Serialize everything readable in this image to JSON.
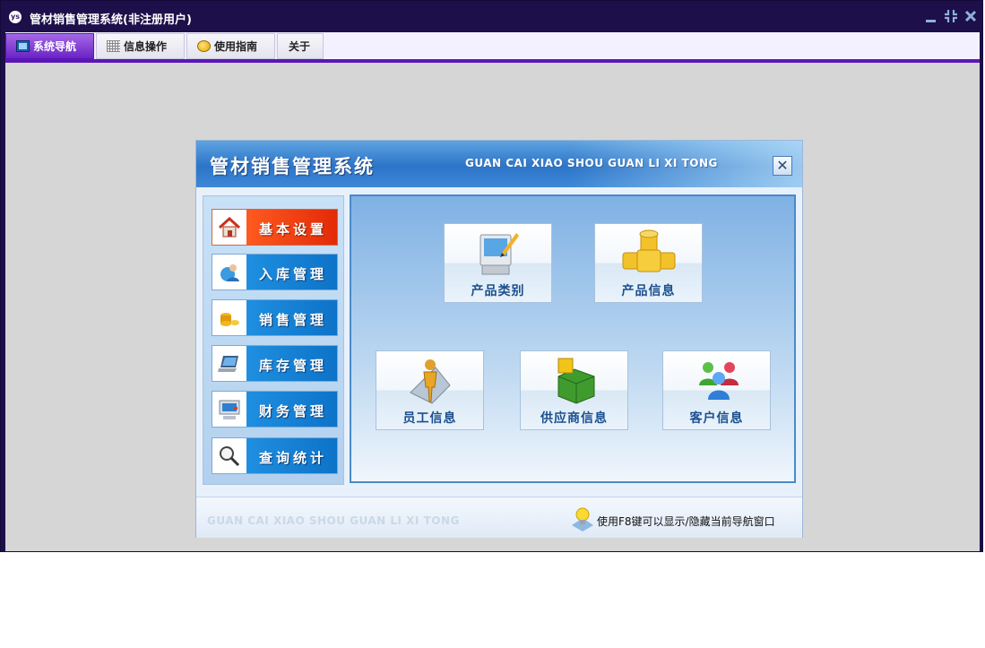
{
  "window": {
    "title": "管材销售管理系统(非注册用户)",
    "app_icon_text": "ys"
  },
  "menubar": {
    "tabs": [
      {
        "label": "系统导航",
        "icon": "monitor-icon",
        "active": true
      },
      {
        "label": "信息操作",
        "icon": "grid-icon",
        "active": false
      },
      {
        "label": "使用指南",
        "icon": "info-dot-icon",
        "active": false
      },
      {
        "label": "关于",
        "icon": "",
        "active": false
      }
    ]
  },
  "colors": {
    "accent": "#5b16b8",
    "title_bg": "#1d0f4a",
    "workspace": "#d6d6d6",
    "active_menu": "#e22a08",
    "menu_blue": "#0d73c8"
  },
  "nav": {
    "title": "管材销售管理系统",
    "subtitle": "GUAN CAI XIAO SHOU GUAN LI XI TONG",
    "close": "✕",
    "menu": [
      {
        "label": "基本设置",
        "icon": "home-icon",
        "active": true
      },
      {
        "label": "入库管理",
        "icon": "user-globe-icon",
        "active": false
      },
      {
        "label": "销售管理",
        "icon": "coins-icon",
        "active": false
      },
      {
        "label": "库存管理",
        "icon": "laptop-icon",
        "active": false
      },
      {
        "label": "财务管理",
        "icon": "computer-icon",
        "active": false
      },
      {
        "label": "查询统计",
        "icon": "magnifier-icon",
        "active": false
      }
    ],
    "tiles": [
      {
        "label": "产品类别",
        "icon": "monitor-pencil-icon"
      },
      {
        "label": "产品信息",
        "icon": "pipe-tee-icon"
      },
      {
        "label": "员工信息",
        "icon": "person-icon"
      },
      {
        "label": "供应商信息",
        "icon": "box-icon"
      },
      {
        "label": "客户信息",
        "icon": "people-group-icon"
      }
    ],
    "footer_brand": "GUAN CAI XIAO SHOU GUAN LI XI TONG",
    "footer_hint": "使用F8键可以显示/隐藏当前导航窗口"
  }
}
